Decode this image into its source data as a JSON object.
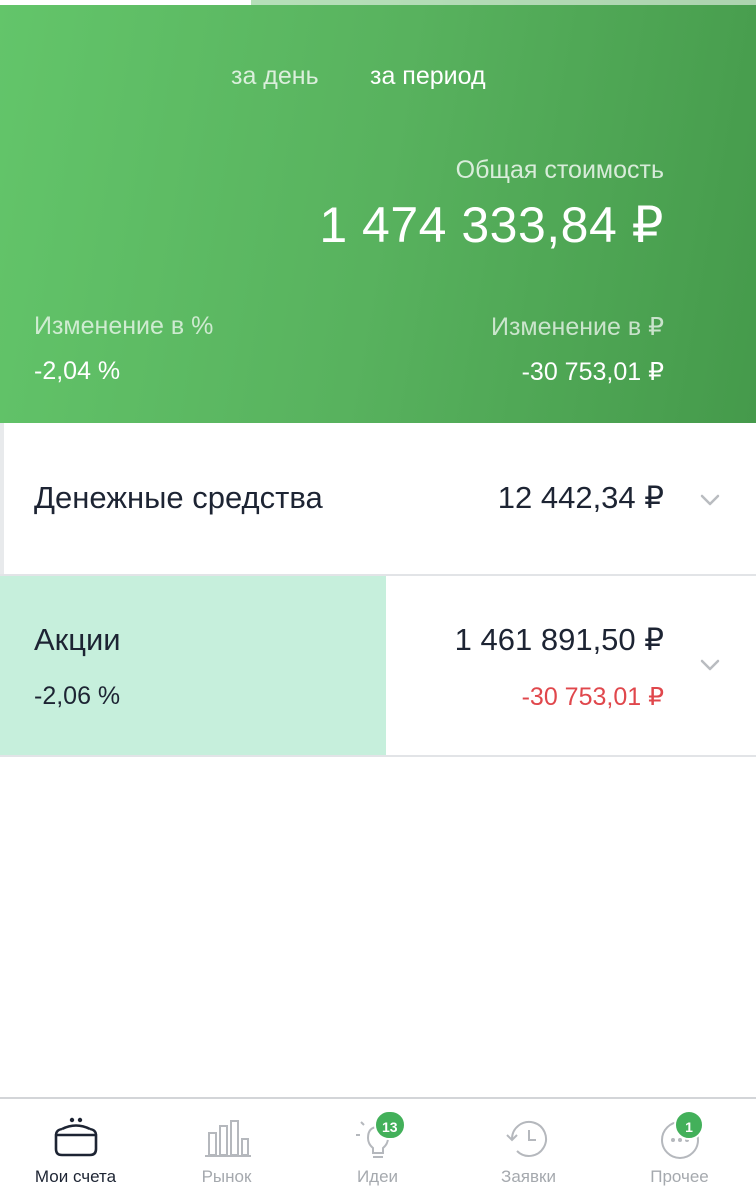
{
  "colors": {
    "accent_green": "#58b25e",
    "header_gradient_start": "#63c56a",
    "header_gradient_end": "#459a4b",
    "stocks_highlight": "#c6efdc",
    "negative_red": "#e0474c",
    "badge_green": "#43b05a",
    "text_dark": "#1d2433",
    "nav_inactive": "#a5a9ae"
  },
  "header": {
    "tabs": [
      {
        "label": "за день",
        "active": false
      },
      {
        "label": "за период",
        "active": true
      }
    ],
    "total_label": "Общая стоимость",
    "total_value": "1 474 333,84 ₽",
    "change_pct_label": "Изменение в  %",
    "change_pct_value": "-2,04  %",
    "change_rub_label": "Изменение в ₽",
    "change_rub_value": "-30 753,01 ₽"
  },
  "rows": {
    "cash": {
      "title": "Денежные средства",
      "amount": "12 442,34 ₽",
      "icon": "chevron-down-icon"
    },
    "stocks": {
      "title": "Акции",
      "change_pct": "-2,06  %",
      "amount": "1 461 891,50 ₽",
      "change_rub": "-30 753,01 ₽",
      "icon": "chevron-down-icon"
    }
  },
  "nav": {
    "items": [
      {
        "label": "Мои счета",
        "icon": "wallet-icon",
        "active": true
      },
      {
        "label": "Рынок",
        "icon": "bar-chart-icon",
        "active": false
      },
      {
        "label": "Идеи",
        "icon": "lightbulb-icon",
        "active": false,
        "badge": "13"
      },
      {
        "label": "Заявки",
        "icon": "history-icon",
        "active": false
      },
      {
        "label": "Прочее",
        "icon": "more-icon",
        "active": false,
        "badge": "1"
      }
    ]
  }
}
